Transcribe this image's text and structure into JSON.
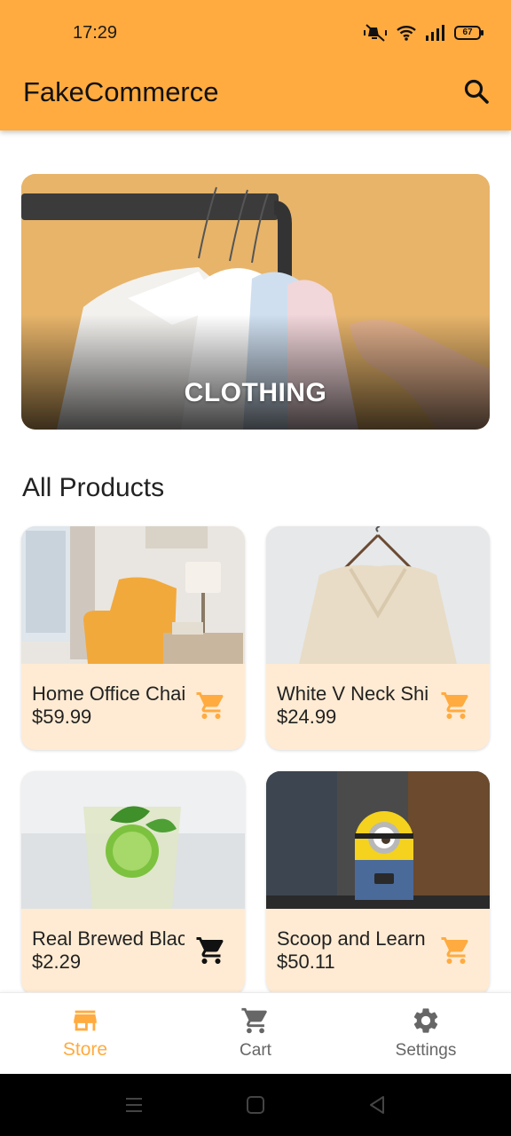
{
  "status_bar": {
    "time": "17:29",
    "battery": "67"
  },
  "app_bar": {
    "title": "FakeCommerce",
    "search_icon": "search-icon"
  },
  "hero": {
    "label": "CLOTHING"
  },
  "section": {
    "title": "All Products"
  },
  "products": [
    {
      "name": "Home Office Chair",
      "price": "$59.99",
      "cart_color": "#FFAB40"
    },
    {
      "name": "White V Neck Shirt",
      "price": "$24.99",
      "cart_color": "#FFAB40"
    },
    {
      "name": "Real Brewed Black Tea",
      "price": "$2.29",
      "cart_color": "#111111"
    },
    {
      "name": "Scoop and Learn",
      "price": "$50.11",
      "cart_color": "#FFAB40"
    }
  ],
  "bottom_nav": {
    "items": [
      {
        "label": "Store",
        "icon": "store-icon"
      },
      {
        "label": "Cart",
        "icon": "cart-icon"
      },
      {
        "label": "Settings",
        "icon": "gear-icon"
      }
    ],
    "active": "Store"
  },
  "colors": {
    "accent": "#FFAB40",
    "card_bg": "#FFEBD3"
  }
}
